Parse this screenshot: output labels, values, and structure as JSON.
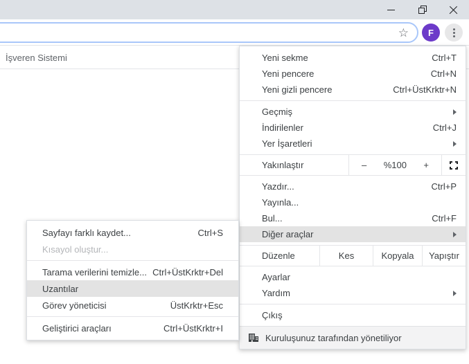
{
  "title_bar": {
    "icons": {
      "minimize": "–",
      "restore": "❐",
      "close": "✕"
    }
  },
  "toolbar": {
    "icons": {
      "bookmark_star": "☆",
      "more_vertical": "⋮"
    },
    "avatar_letter": "F",
    "avatar_color": "#6c3ac9",
    "omnibox_border_color": "#a9c7fa"
  },
  "page": {
    "heading": "İşveren Sistemi"
  },
  "main_menu": {
    "items": [
      {
        "label": "Yeni sekme",
        "shortcut": "Ctrl+T"
      },
      {
        "label": "Yeni pencere",
        "shortcut": "Ctrl+N"
      },
      {
        "label": "Yeni gizli pencere",
        "shortcut": "Ctrl+ÜstKrktr+N"
      },
      {
        "label": "Geçmiş",
        "has_submenu": true
      },
      {
        "label": "İndirilenler",
        "shortcut": "Ctrl+J"
      },
      {
        "label": "Yer İşaretleri",
        "has_submenu": true
      },
      {
        "label": "Yazdır...",
        "shortcut": "Ctrl+P"
      },
      {
        "label": "Yayınla..."
      },
      {
        "label": "Bul...",
        "shortcut": "Ctrl+F"
      },
      {
        "label": "Diğer araçlar",
        "has_submenu": true,
        "highlighted": true
      },
      {
        "label": "Ayarlar"
      },
      {
        "label": "Yardım",
        "has_submenu": true
      },
      {
        "label": "Çıkış"
      }
    ],
    "zoom": {
      "label": "Yakınlaştır",
      "decrease": "–",
      "level": "%100",
      "increase": "+",
      "fullscreen_icon": "⛶"
    },
    "edit": {
      "label": "Düzenle",
      "cut": "Kes",
      "copy": "Kopyala",
      "paste": "Yapıştır"
    },
    "footer": {
      "icon": "🏢",
      "text": "Kuruluşunuz tarafından yönetiliyor"
    },
    "highlight_color": "#e3e3e3"
  },
  "sub_menu": {
    "items": [
      {
        "label": "Sayfayı farklı kaydet...",
        "shortcut": "Ctrl+S"
      },
      {
        "label": "Kısayol oluştur...",
        "disabled": true
      },
      {
        "label": "Tarama verilerini temizle...",
        "shortcut": "Ctrl+ÜstKrktr+Del"
      },
      {
        "label": "Uzantılar",
        "highlighted": true
      },
      {
        "label": "Görev yöneticisi",
        "shortcut": "ÜstKrktr+Esc"
      },
      {
        "label": "Geliştirici araçları",
        "shortcut": "Ctrl+ÜstKrktr+I"
      }
    ]
  }
}
